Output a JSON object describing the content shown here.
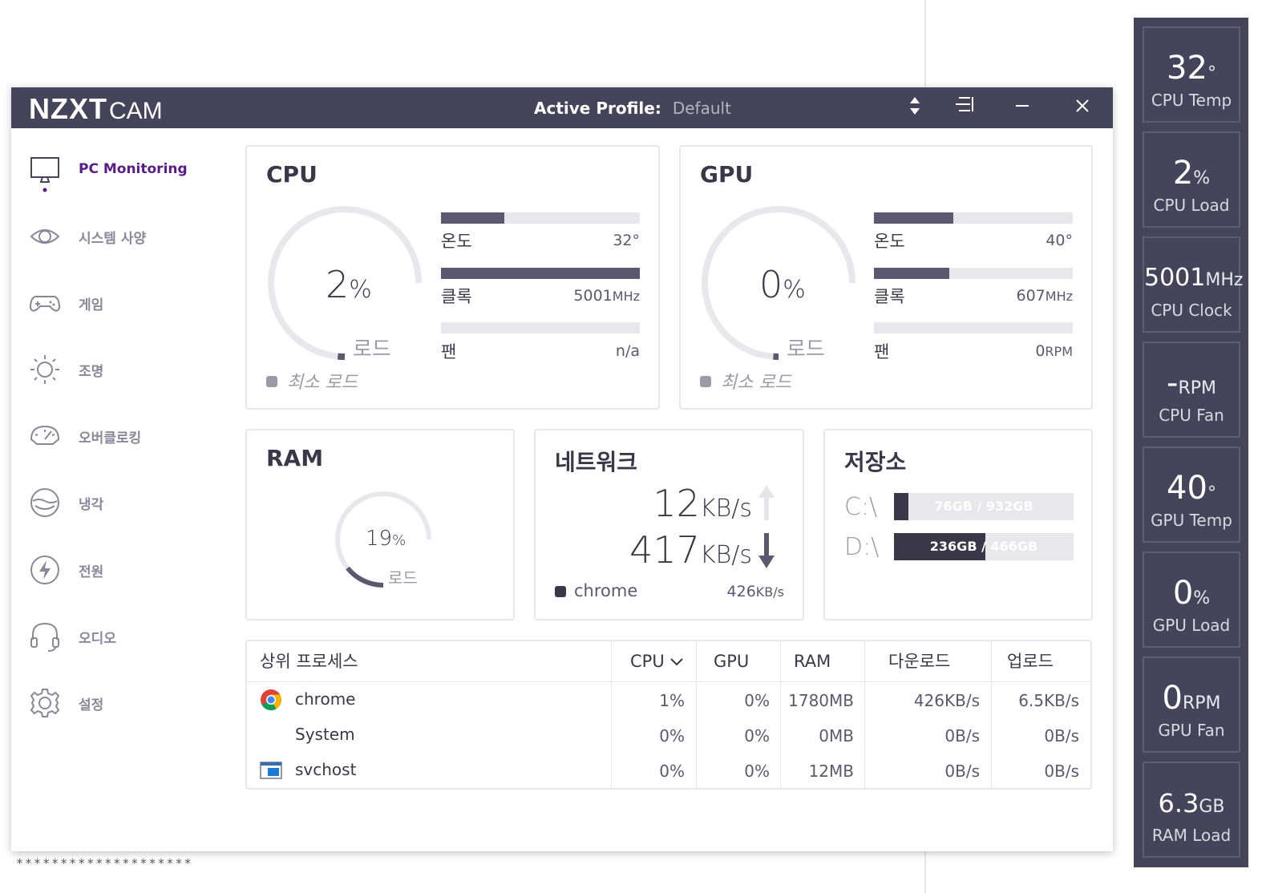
{
  "app": {
    "logo_main": "NZXT",
    "logo_sub": "CAM",
    "profile_label": "Active Profile:",
    "profile_value": "Default"
  },
  "titlebar_icons": [
    "sort-icon",
    "menu-icon",
    "minimize-icon",
    "close-icon"
  ],
  "sidebar": {
    "items": [
      {
        "label": "PC Monitoring",
        "icon": "monitor-icon",
        "active": true
      },
      {
        "label": "시스템 사양",
        "icon": "eye-icon"
      },
      {
        "label": "게임",
        "icon": "gamepad-icon"
      },
      {
        "label": "조명",
        "icon": "sun-icon"
      },
      {
        "label": "오버클로킹",
        "icon": "gauge-icon"
      },
      {
        "label": "냉각",
        "icon": "cooling-icon"
      },
      {
        "label": "전원",
        "icon": "power-icon"
      },
      {
        "label": "오디오",
        "icon": "headset-icon"
      },
      {
        "label": "설정",
        "icon": "gear-icon"
      }
    ]
  },
  "cpu": {
    "title": "CPU",
    "load_value": "2",
    "load_unit": "%",
    "load_label": "로드",
    "load_fraction": 0.02,
    "min_load_label": "최소 로드",
    "temp_label": "온도",
    "temp_value": "32°",
    "temp_fraction": 0.32,
    "clock_label": "클록",
    "clock_value": "5001",
    "clock_unit": "MHz",
    "clock_fraction": 1.0,
    "fan_label": "팬",
    "fan_value": "n/a",
    "fan_fraction": 0
  },
  "gpu": {
    "title": "GPU",
    "load_value": "0",
    "load_unit": "%",
    "load_label": "로드",
    "load_fraction": 0.0,
    "min_load_label": "최소 로드",
    "temp_label": "온도",
    "temp_value": "40°",
    "temp_fraction": 0.4,
    "clock_label": "클록",
    "clock_value": "607",
    "clock_unit": "MHz",
    "clock_fraction": 0.38,
    "fan_label": "팬",
    "fan_value": "0",
    "fan_unit": "RPM",
    "fan_fraction": 0
  },
  "ram": {
    "title": "RAM",
    "load_value": "19",
    "load_unit": "%",
    "load_label": "로드",
    "load_fraction": 0.19
  },
  "network": {
    "title": "네트워크",
    "up_value": "12",
    "up_unit": "KB/s",
    "down_value": "417",
    "down_unit": "KB/s",
    "top_process": "chrome",
    "top_process_value": "426",
    "top_process_unit": "KB/s"
  },
  "storage": {
    "title": "저장소",
    "drives": [
      {
        "label": "C:\\",
        "used": "76GB",
        "total": "932GB",
        "text": "76GB / 932GB",
        "fraction": 0.08
      },
      {
        "label": "D:\\",
        "used": "236GB",
        "total": "466GB",
        "text": "236GB / 466GB",
        "fraction": 0.51
      }
    ]
  },
  "processes": {
    "headers": {
      "name": "상위 프로세스",
      "cpu": "CPU",
      "gpu": "GPU",
      "ram": "RAM",
      "download": "다운로드",
      "upload": "업로드"
    },
    "rows": [
      {
        "name": "chrome",
        "icon": "chrome-icon",
        "cpu": "1%",
        "gpu": "0%",
        "ram": "1780MB",
        "download": "426KB/s",
        "upload": "6.5KB/s"
      },
      {
        "name": "System",
        "icon": "",
        "cpu": "0%",
        "gpu": "0%",
        "ram": "0MB",
        "download": "0B/s",
        "upload": "0B/s"
      },
      {
        "name": "svchost",
        "icon": "window-icon",
        "cpu": "0%",
        "gpu": "0%",
        "ram": "12MB",
        "download": "0B/s",
        "upload": "0B/s"
      }
    ]
  },
  "overlay": {
    "tiles": [
      {
        "value": "32",
        "unit": "°",
        "name": "CPU Temp"
      },
      {
        "value": "2",
        "unit": "%",
        "name": "CPU Load"
      },
      {
        "value": "5001",
        "unit": "MHz",
        "name": "CPU Clock"
      },
      {
        "value": "-",
        "unit": "RPM",
        "name": "CPU Fan"
      },
      {
        "value": "40",
        "unit": "°",
        "name": "GPU Temp"
      },
      {
        "value": "0",
        "unit": "%",
        "name": "GPU Load"
      },
      {
        "value": "0",
        "unit": "RPM",
        "name": "GPU Fan"
      },
      {
        "value": "6.3",
        "unit": "GB",
        "name": "RAM Load"
      }
    ]
  },
  "footer_text": "********************",
  "colors": {
    "titlebar": "#46445a",
    "accent": "#5a1a8c",
    "bar_fill": "#5b5870",
    "bar_track": "#e8e8ec"
  }
}
